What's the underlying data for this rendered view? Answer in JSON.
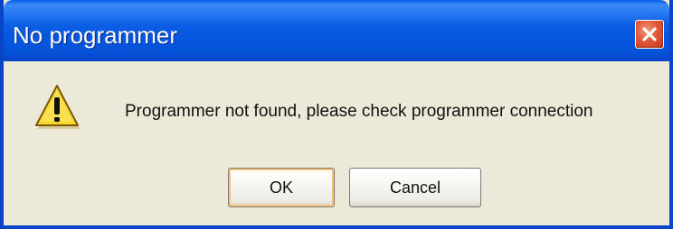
{
  "window": {
    "title": "No programmer"
  },
  "message": {
    "text": "Programmer not found, please check programmer connection",
    "icon": "warning-icon"
  },
  "buttons": {
    "ok_label": "OK",
    "cancel_label": "Cancel"
  },
  "colors": {
    "titlebar": "#0a5de8",
    "dialog_background": "#ece9d8",
    "close_button": "#e25a3a",
    "warning_yellow": "#f8d62a"
  }
}
